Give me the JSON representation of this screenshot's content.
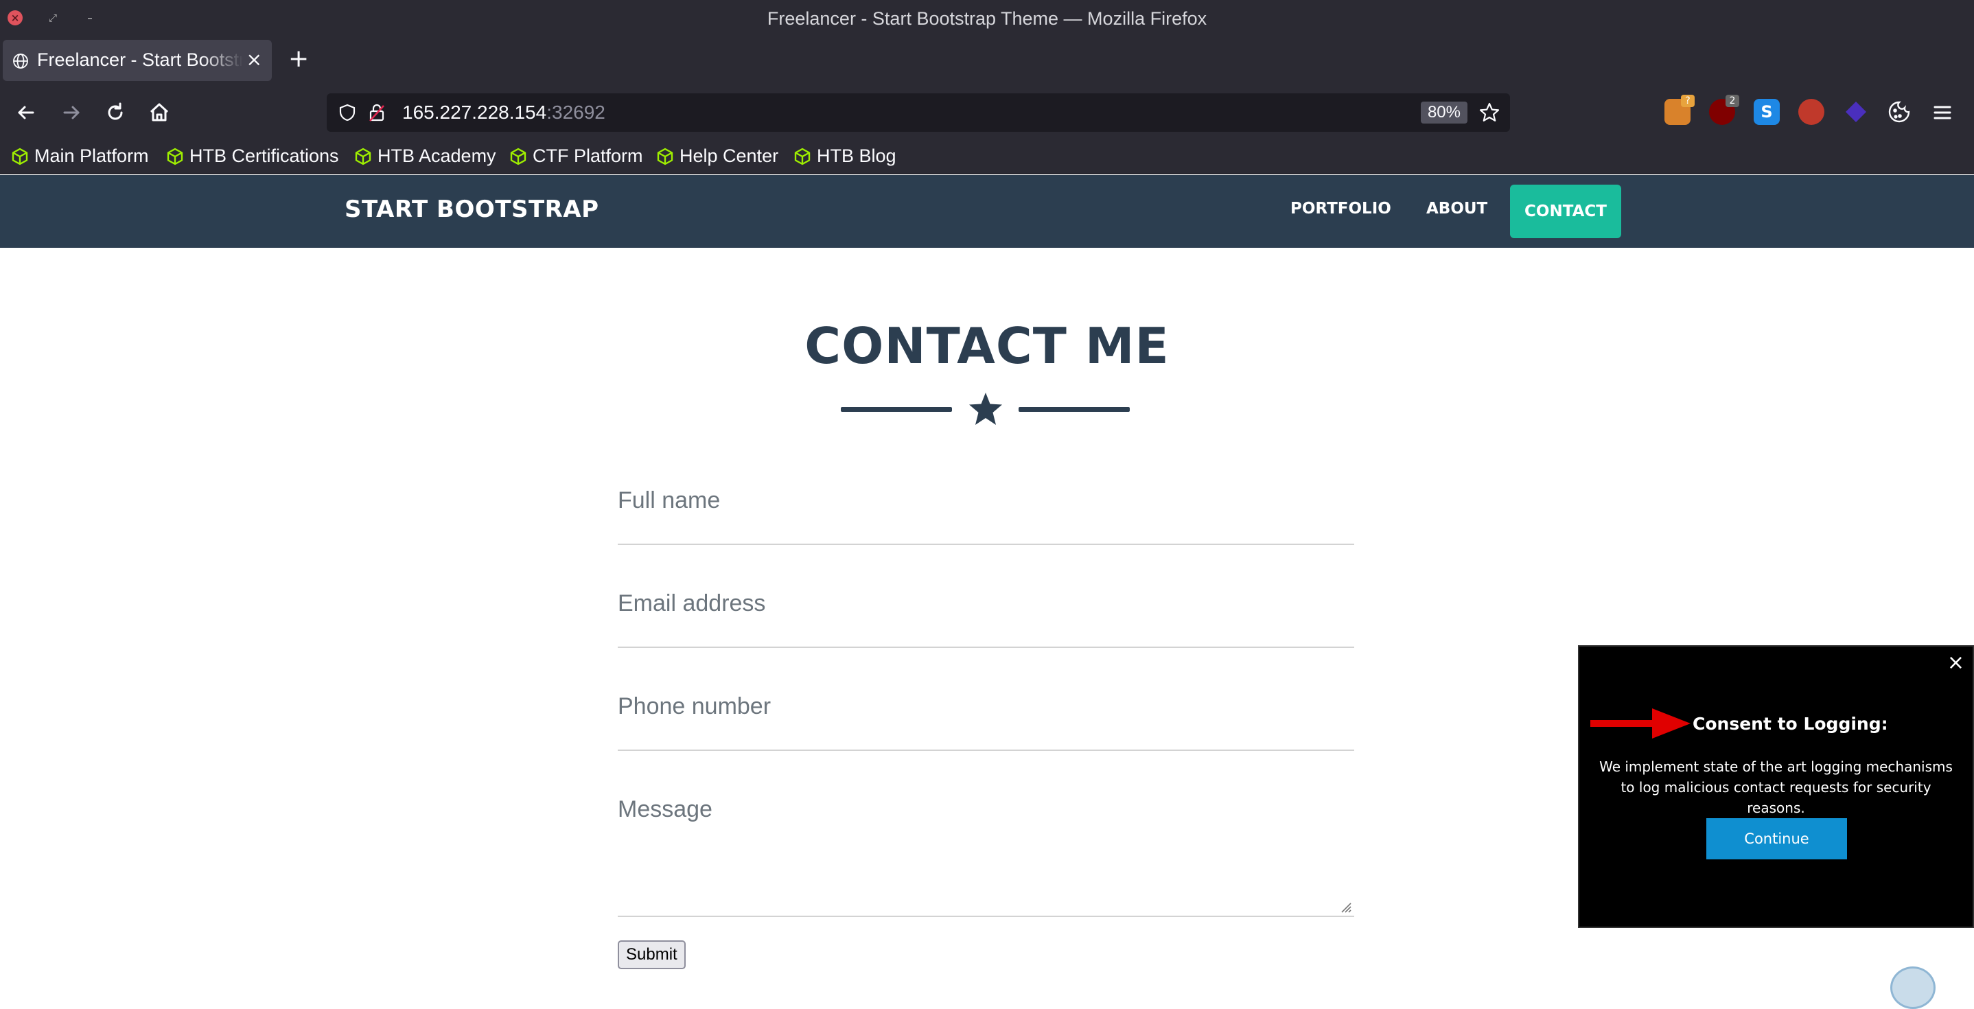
{
  "window": {
    "title": "Freelancer - Start Bootstrap Theme — Mozilla Firefox"
  },
  "tabs": [
    {
      "title": "Freelancer - Start Bootstrap Theme",
      "active": true
    }
  ],
  "urlbar": {
    "host": "165.227.228.154",
    "port": ":32692",
    "zoom": "80%"
  },
  "extensions": [
    {
      "name": "foxyproxy-icon",
      "badge": "?",
      "color": "#d9822b"
    },
    {
      "name": "ublock-icon",
      "badge": "2",
      "color": "#800000"
    },
    {
      "name": "s-extension-icon",
      "badge": "",
      "color": "#1e88e5"
    },
    {
      "name": "fox-extension-icon",
      "badge": "",
      "color": "#c0392b"
    },
    {
      "name": "wappalyzer-icon",
      "badge": "",
      "color": "#4a2fbd"
    },
    {
      "name": "cookie-icon",
      "badge": "",
      "color": "#2b2a33"
    }
  ],
  "bookmarks": [
    "Main Platform",
    "HTB Certifications",
    "HTB Academy",
    "CTF Platform",
    "Help Center",
    "HTB Blog"
  ],
  "site": {
    "brand": "START BOOTSTRAP",
    "nav": {
      "portfolio": "PORTFOLIO",
      "about": "ABOUT",
      "contact": "CONTACT"
    },
    "accent": "#1abc9c",
    "navbar_color": "#2c3e50"
  },
  "contact": {
    "heading": "CONTACT ME",
    "fields": {
      "name_placeholder": "Full name",
      "email_placeholder": "Email address",
      "phone_placeholder": "Phone number",
      "message_placeholder": "Message"
    },
    "submit_label": "Submit"
  },
  "popup": {
    "close": "×",
    "title": "Consent to Logging:",
    "body": "We implement state of the art logging mechanisms to log malicious contact requests for security reasons.",
    "button": "Continue"
  }
}
